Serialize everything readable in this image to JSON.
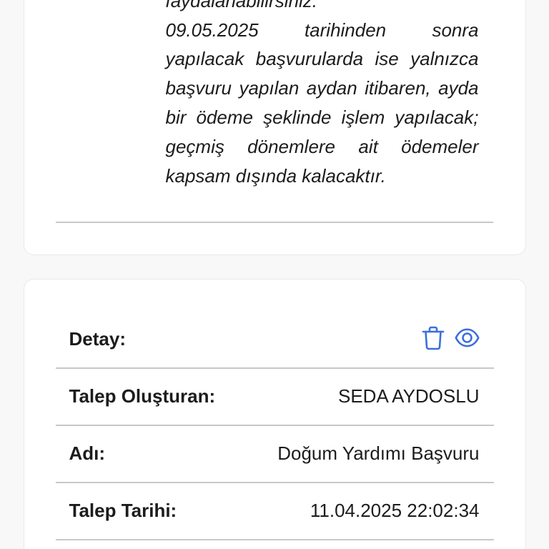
{
  "notice": {
    "lines": [
      "faydalanabilirsiniz.",
      "09.05.2025 tarihinden sonra",
      "yapılacak başvurularda ise yalnızca",
      "başvuru yapılan aydan itibaren, ayda",
      "bir ödeme şeklinde işlem yapılacak;",
      "geçmiş dönemlere ait ödemeler",
      "kapsam dışında kalacaktır."
    ]
  },
  "request_details": {
    "detail_label": "Detay:",
    "actions": {
      "delete_icon": "trash-icon",
      "view_icon": "eye-icon"
    },
    "rows": [
      {
        "label": "Talep Oluşturan:",
        "value": "SEDA AYDOSLU"
      },
      {
        "label": "Adı:",
        "value": "Doğum Yardımı Başvuru"
      },
      {
        "label": "Talep Tarihi:",
        "value": "11.04.2025 22:02:34"
      }
    ]
  },
  "colors": {
    "accent": "#3b6fdc",
    "text": "#1c1c1e",
    "divider": "#c8c8c8",
    "card_border": "#e8e8ea",
    "background": "#f8f8f9"
  }
}
